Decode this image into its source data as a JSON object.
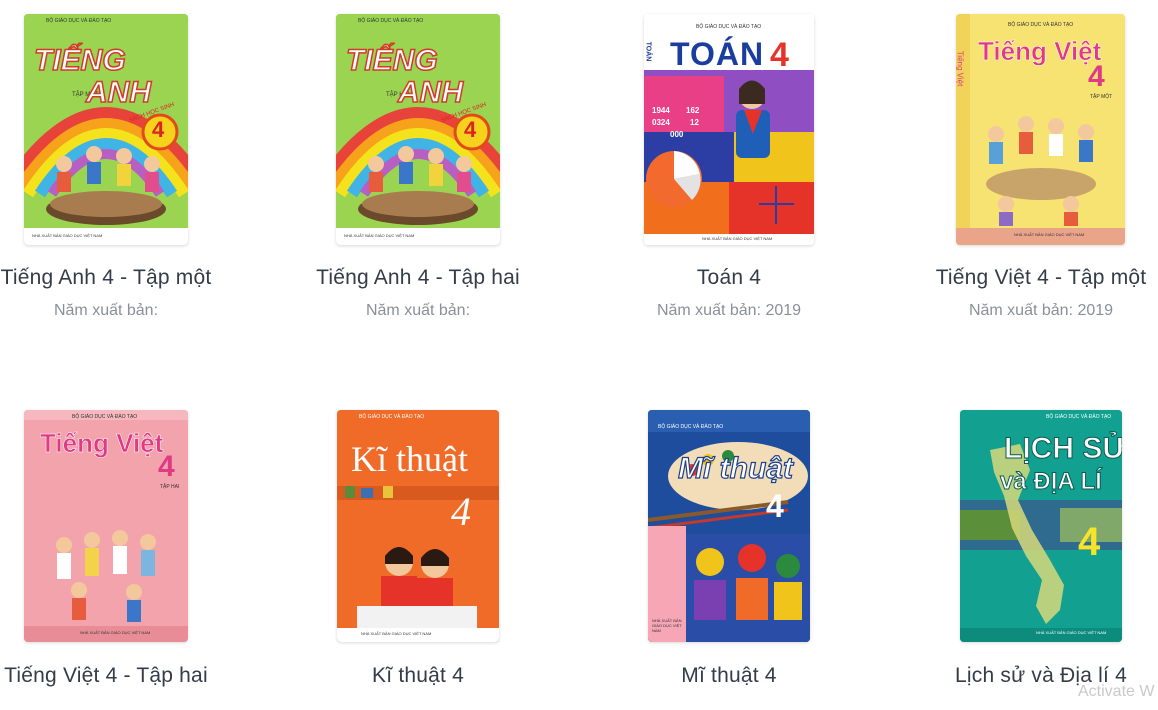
{
  "books": [
    {
      "title": "Tiếng Anh 4 - Tập một",
      "year_label": "Năm xuất bản:",
      "cover": {
        "header": "BỘ GIÁO DỤC VÀ ĐÀO TẠO",
        "line1": "TIẾNG",
        "line2": "ANH",
        "sub": "TẬP MỘT",
        "side": "SÁCH HỌC SINH",
        "grade": "4",
        "footer": "NHÀ XUẤT BẢN GIÁO DỤC VIỆT NAM"
      }
    },
    {
      "title": "Tiếng Anh 4 - Tập hai",
      "year_label": "Năm xuất bản:",
      "cover": {
        "header": "BỘ GIÁO DỤC VÀ ĐÀO TẠO",
        "line1": "TIẾNG",
        "line2": "ANH",
        "sub": "TẬP HAI",
        "side": "SÁCH HỌC SINH",
        "grade": "4",
        "footer": "NHÀ XUẤT BẢN GIÁO DỤC VIỆT NAM"
      }
    },
    {
      "title": "Toán 4",
      "year_label": "Năm xuất bản: 2019",
      "cover": {
        "header": "BỘ GIÁO DỤC VÀ ĐÀO TẠO",
        "line1": "TOÁN",
        "grade": "4",
        "side": "TOÁN",
        "calc1": "1944",
        "calc2": "162",
        "calc3": "0324",
        "calc4": "12",
        "calc5": "000",
        "footer": "NHÀ XUẤT BẢN GIÁO DỤC VIỆT NAM"
      }
    },
    {
      "title": "Tiếng Việt 4 - Tập một",
      "year_label": "Năm xuất bản: 2019",
      "cover": {
        "header": "BỘ GIÁO DỤC VÀ ĐÀO TẠO",
        "line1": "Tiếng Việt",
        "grade": "4",
        "sub": "TẬP MỘT",
        "side": "Tiếng Việt",
        "footer": "NHÀ XUẤT BẢN GIÁO DỤC VIỆT NAM"
      }
    },
    {
      "title": "Tiếng Việt 4 - Tập hai",
      "year_label": "",
      "cover": {
        "header": "BỘ GIÁO DỤC VÀ ĐÀO TẠO",
        "line1": "Tiếng Việt",
        "grade": "4",
        "sub": "TẬP HAI",
        "footer": "NHÀ XUẤT BẢN GIÁO DỤC VIỆT NAM"
      }
    },
    {
      "title": "Kĩ thuật 4",
      "year_label": "",
      "cover": {
        "header": "BỘ GIÁO DỤC VÀ ĐÀO TẠO",
        "line1": "Kĩ thuật",
        "grade": "4",
        "footer": "NHÀ XUẤT BẢN GIÁO DỤC VIỆT NAM"
      }
    },
    {
      "title": "Mĩ thuật 4",
      "year_label": "",
      "cover": {
        "header": "BỘ GIÁO DỤC VÀ ĐÀO TẠO",
        "line1": "Mĩ thuật",
        "grade": "4",
        "footer": "NHÀ XUẤT BẢN GIÁO DỤC VIỆT NAM"
      }
    },
    {
      "title": "Lịch sử và Địa lí 4",
      "year_label": "",
      "cover": {
        "header": "BỘ GIÁO DỤC VÀ ĐÀO TẠO",
        "line1": "LỊCH SỬ",
        "line2": "và ĐỊA LÍ",
        "grade": "4",
        "footer": "NHÀ XUẤT BẢN GIÁO DỤC VIỆT NAM"
      }
    }
  ],
  "watermark": "Activate W",
  "colors": {
    "title": "#333c48",
    "year": "#8a9099"
  }
}
